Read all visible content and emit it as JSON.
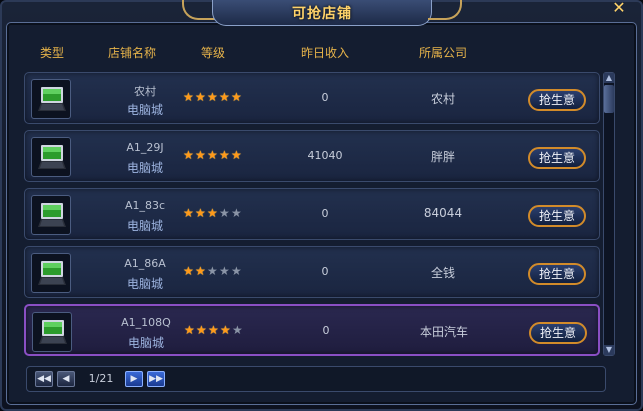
{
  "window": {
    "title": "可抢店铺",
    "close_label": "✕"
  },
  "columns": {
    "type": "类型",
    "name": "店铺名称",
    "level": "等级",
    "income": "昨日收入",
    "company": "所属公司"
  },
  "rows": [
    {
      "icon": "laptop-icon",
      "name": "农村",
      "shop_type": "电脑城",
      "stars": 5,
      "income": "0",
      "company": "农村",
      "button": "抢生意"
    },
    {
      "icon": "laptop-icon",
      "name": "A1_29J",
      "shop_type": "电脑城",
      "stars": 5,
      "income": "41040",
      "company": "胖胖",
      "button": "抢生意"
    },
    {
      "icon": "laptop-icon",
      "name": "A1_83c",
      "shop_type": "电脑城",
      "stars": 3,
      "income": "0",
      "company": "84044",
      "button": "抢生意"
    },
    {
      "icon": "laptop-icon",
      "name": "A1_86A",
      "shop_type": "电脑城",
      "stars": 2,
      "income": "0",
      "company": "全钱",
      "button": "抢生意"
    },
    {
      "icon": "laptop-icon",
      "name": "A1_108Q",
      "shop_type": "电脑城",
      "stars": 4,
      "income": "0",
      "company": "本田汽车",
      "button": "抢生意",
      "selected": true
    }
  ],
  "pager": {
    "label": "1/21",
    "first": "◀◀",
    "prev": "◀",
    "next": "▶",
    "last": "▶▶"
  },
  "colors": {
    "title": "#ffd36a",
    "header": "#e6b34a",
    "star_on": "#ff9a1a",
    "star_off": "#8a94a6",
    "selected_border": "#8a4fc4",
    "button_border": "#d28b2a"
  },
  "star_max": 5
}
